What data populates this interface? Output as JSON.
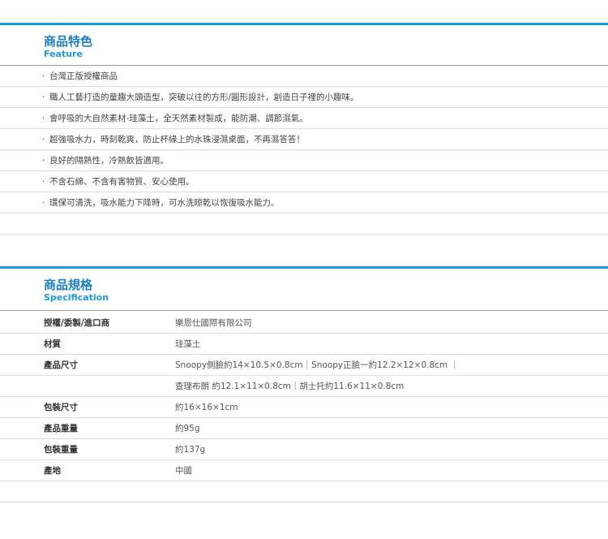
{
  "feature": {
    "title_zh": "商品特色",
    "title_en": "Feature",
    "bullet": "·",
    "items": [
      "台灣正版授權商品",
      "職人工藝打造的童趣大頭造型，突破以往的方形/圓形設計，創造日子裡的小趣味。",
      "會呼吸的大自然素材-珪藻土，全天然素材製成，能防潮、調節濕氣。",
      "超強吸水力，時刻乾爽，防止杯緣上的水珠浸濕桌面，不再濕答答！",
      "良好的隔熱性，冷熱飲皆適用。",
      "不含石綿、不含有害物質、安心使用。",
      "環保可清洗，吸水能力下降時，可水洗晾乾以恢復吸水能力。"
    ]
  },
  "specification": {
    "title_zh": "商品規格",
    "title_en": "Specification",
    "rows": [
      {
        "label": "授權/委製/進口商",
        "value": "樂恩仕國際有限公司"
      },
      {
        "label": "材質",
        "value": "珪藻土"
      },
      {
        "label": "產品尺寸",
        "value": "Snoopy側臉約14×10.5×0.8cm｜Snoopy正臉一約12.2×12×0.8cm ｜"
      },
      {
        "label": "",
        "value": "查理布朗 約12.1×11×0.8cm｜胡士托約11.6×11×0.8cm"
      },
      {
        "label": "包裝尺寸",
        "value": "約16×16×1cm"
      },
      {
        "label": "產品重量",
        "value": "約95g"
      },
      {
        "label": "包裝重量",
        "value": "約137g"
      },
      {
        "label": "產地",
        "value": "中國"
      }
    ]
  }
}
